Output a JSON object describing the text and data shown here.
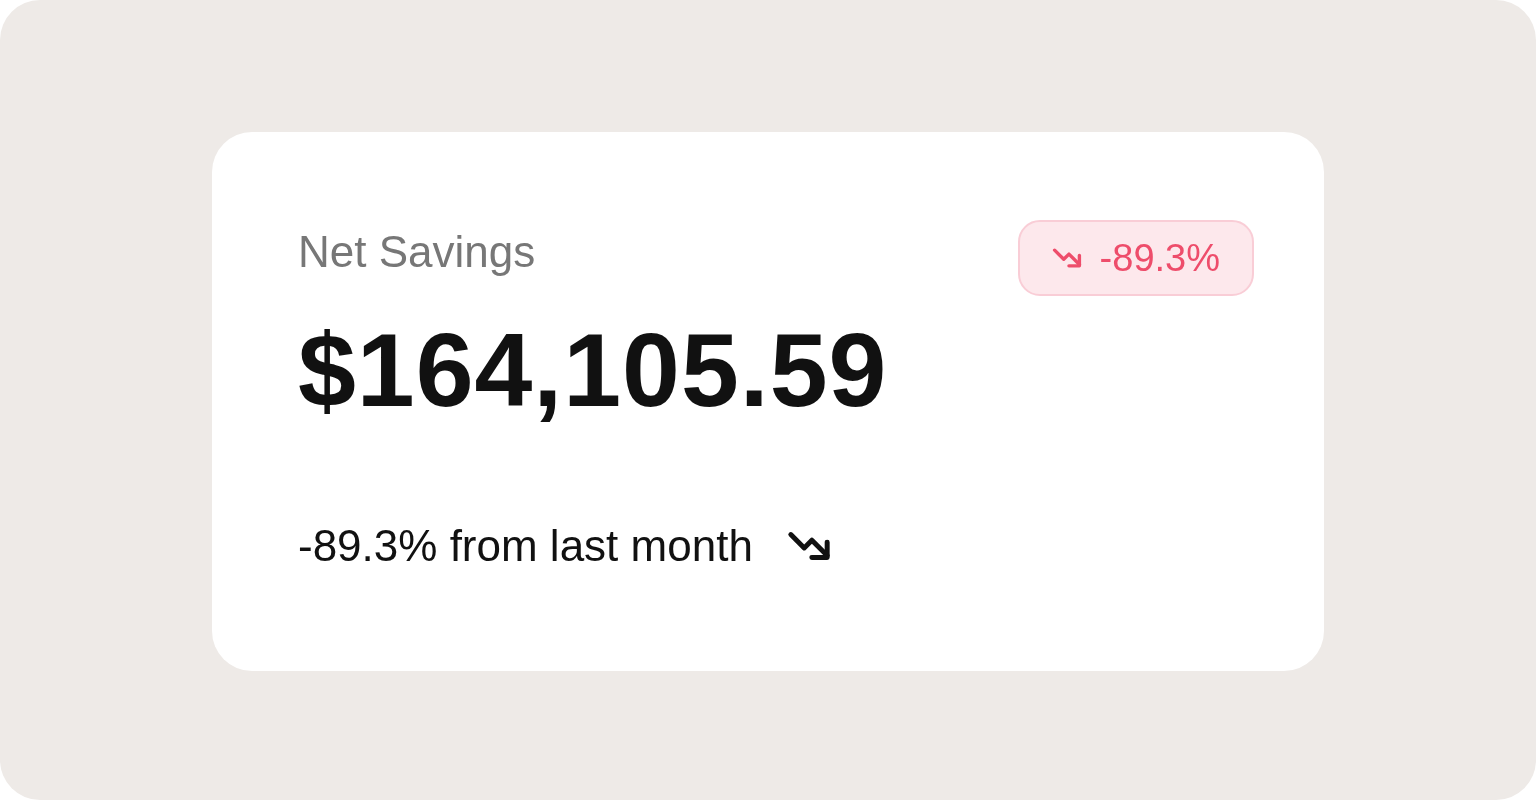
{
  "card": {
    "title": "Net Savings",
    "value": "$164,105.59",
    "decreasing": true,
    "badge": {
      "text": "-89.3%"
    },
    "footer": {
      "text": "-89.3% from last month"
    }
  }
}
